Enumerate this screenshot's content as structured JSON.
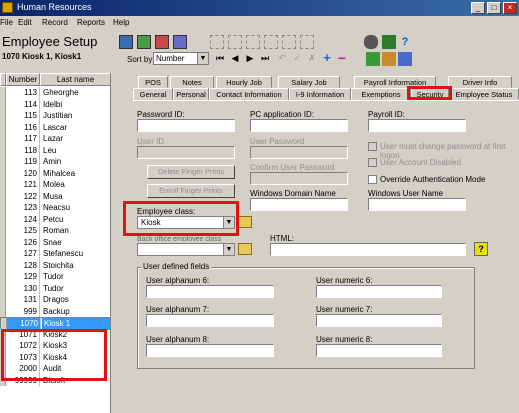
{
  "window": {
    "title": "Human Resources"
  },
  "menu": [
    "File",
    "Edit",
    "Record",
    "Reports",
    "Help"
  ],
  "header": {
    "app_title": "Employee Setup",
    "employee": "1070  Kiosk 1, Kiosk1",
    "sort_label": "Sort by:",
    "sort_value": "Number"
  },
  "list": {
    "col_number": "Number",
    "col_last": "Last name",
    "rows": [
      {
        "num": "113",
        "name": "Gheorghe"
      },
      {
        "num": "114",
        "name": "Idelbi"
      },
      {
        "num": "115",
        "name": "Justitian"
      },
      {
        "num": "116",
        "name": "Lascar"
      },
      {
        "num": "117",
        "name": "Lazar"
      },
      {
        "num": "118",
        "name": "Leu"
      },
      {
        "num": "119",
        "name": "Amin"
      },
      {
        "num": "120",
        "name": "Mihalcea"
      },
      {
        "num": "121",
        "name": "Molea"
      },
      {
        "num": "122",
        "name": "Musa"
      },
      {
        "num": "123",
        "name": "Neacsu"
      },
      {
        "num": "124",
        "name": "Petcu"
      },
      {
        "num": "125",
        "name": "Roman"
      },
      {
        "num": "126",
        "name": "Snae"
      },
      {
        "num": "127",
        "name": "Stefanescu"
      },
      {
        "num": "128",
        "name": "Stoichita"
      },
      {
        "num": "129",
        "name": "Tudor"
      },
      {
        "num": "130",
        "name": "Tudor"
      },
      {
        "num": "131",
        "name": "Dragos"
      },
      {
        "num": "999",
        "name": "Backup"
      },
      {
        "num": "1070",
        "name": "Kiosk 1"
      },
      {
        "num": "1071",
        "name": "Kiosk2"
      },
      {
        "num": "1072",
        "name": "Kiosk3"
      },
      {
        "num": "1073",
        "name": "Kiosk4"
      },
      {
        "num": "2000",
        "name": "Audit"
      },
      {
        "num": "99999",
        "name": "Bitsoft"
      }
    ]
  },
  "tabs_row1": [
    "POS",
    "Notes",
    "Hourly Job",
    "Salary Job",
    "Payroll Information",
    "Driver Info"
  ],
  "tabs_row2": [
    "General",
    "Personal",
    "Contact Information",
    "I-9 Information",
    "Exemptions",
    "Security",
    "Employee Status"
  ],
  "form": {
    "password_id": "Password ID:",
    "pc_app_id": "PC application ID:",
    "payroll_id": "Payroll ID:",
    "user_id": "User ID",
    "user_password": "User Password",
    "confirm_password": "Confirm User Password",
    "delete_finger": "Delete Finger Prints",
    "enroll_finger": "Enroll Finger Prints",
    "must_change": "User must change password at first logon",
    "account_disabled": "User Account Disabled",
    "override_auth": "Override Authentication Mode",
    "windows_domain": "Windows Domain Name",
    "windows_user": "Windows User Name",
    "employee_class": "Employee class:",
    "employee_class_value": "Kiosk",
    "partial_label": "Back office employee class",
    "html_label": "HTML:",
    "user_defined": "User defined fields",
    "alpha6": "User alphanum 6:",
    "alpha7": "User alphanum 7:",
    "alpha8": "User alphanum 8:",
    "num6": "User numeric 6:",
    "num7": "User numeric 7:",
    "num8": "User numeric 8:"
  },
  "icons": {
    "help": "?"
  }
}
